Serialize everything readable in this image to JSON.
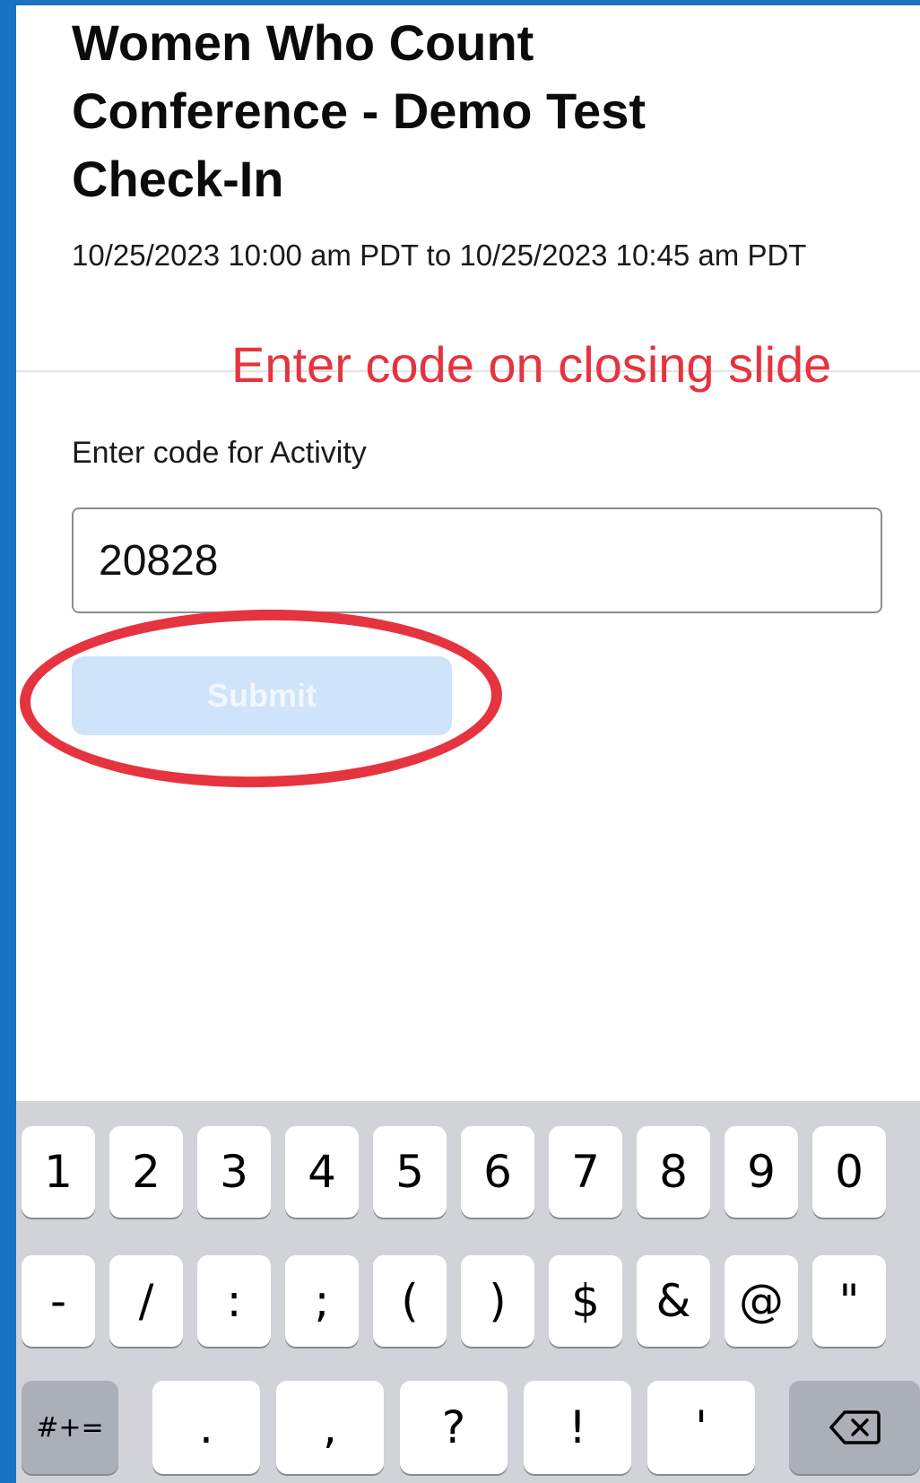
{
  "page": {
    "title_lines": [
      "Women Who Count",
      "Conference - Demo Test",
      "Check-In"
    ],
    "date_range": "10/25/2023 10:00 am PDT to 10/25/2023 10:45 am PDT",
    "annotation": "Enter code on closing slide"
  },
  "form": {
    "label": "Enter code for Activity",
    "code_value": "20828",
    "submit_label": "Submit"
  },
  "keyboard": {
    "row1": [
      "1",
      "2",
      "3",
      "4",
      "5",
      "6",
      "7",
      "8",
      "9",
      "0"
    ],
    "row2": [
      "-",
      "/",
      ":",
      ";",
      "(",
      ")",
      "$",
      "&",
      "@",
      "\""
    ],
    "row3": [
      ".",
      ",",
      "?",
      "!",
      "'"
    ],
    "symbols_toggle": "#+=",
    "delete_icon": "backspace-icon"
  },
  "colors": {
    "frame": "#1a73c2",
    "annotation_red": "#e5343f",
    "submit_disabled": "#cfe3fb"
  }
}
